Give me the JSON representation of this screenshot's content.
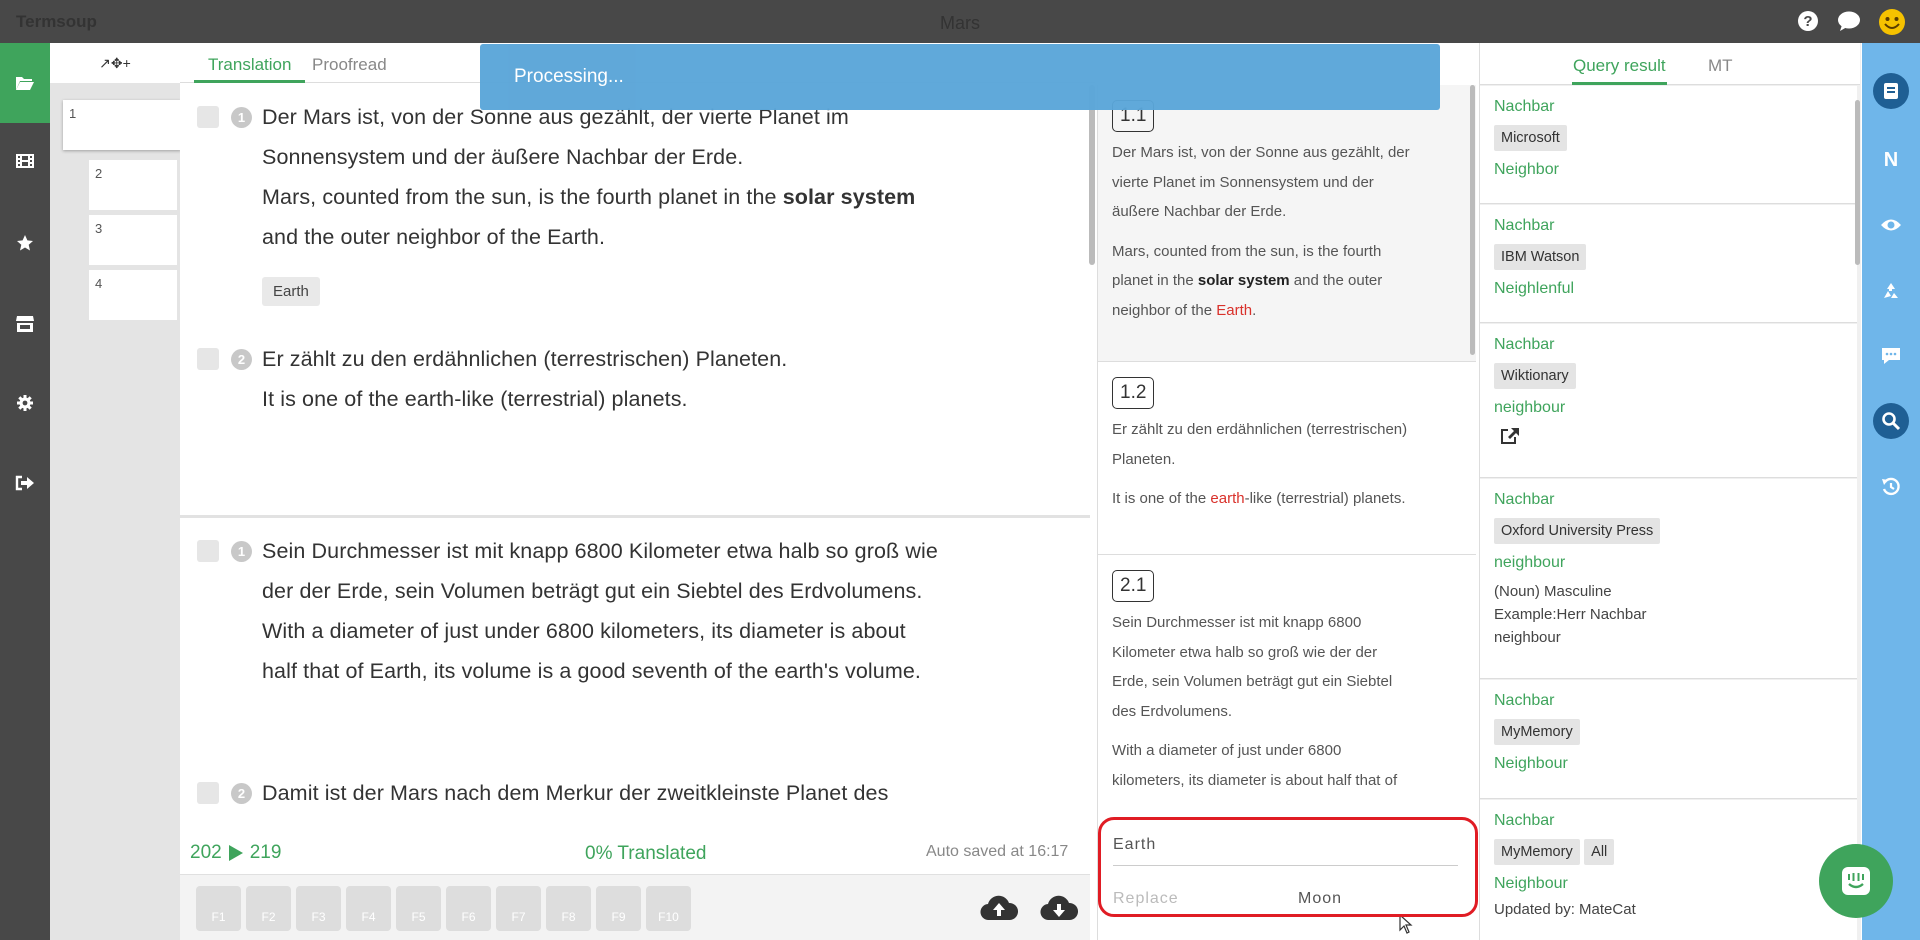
{
  "app": {
    "name": "Termsoup",
    "document_title": "Mars"
  },
  "topbar_icons": [
    "help-icon",
    "chat-icon",
    "smiley-avatar-icon"
  ],
  "left_nav": [
    "folder-icon",
    "film-icon",
    "star-icon",
    "store-icon",
    "gear-icon",
    "sign-out-icon"
  ],
  "thumbs": {
    "tools": "↗✥+",
    "pages": [
      "1",
      "2",
      "3",
      "4"
    ]
  },
  "tabs": {
    "translation": "Translation",
    "proofread": "Proofread"
  },
  "toast": "Processing...",
  "segments": [
    {
      "num": "1",
      "source": [
        "Der Mars ist, von der Sonne aus gezählt, der vierte Planet im",
        "Sonnensystem und der äußere Nachbar der Erde."
      ],
      "target_a": "Mars, counted from the sun, is the fourth planet in the ",
      "target_bold": "solar system",
      "target_b": "and the outer neighbor of the Earth.",
      "term": "Earth"
    },
    {
      "num": "2",
      "source": "Er zählt zu den erdähnlichen (terrestrischen) Planeten.",
      "target": "It is one of the earth-like (terrestrial) planets."
    },
    {
      "num": "1",
      "source": [
        "Sein Durchmesser ist mit knapp 6800 Kilometer etwa halb so groß wie",
        "der der Erde, sein Volumen beträgt gut ein Siebtel des Erdvolumens."
      ],
      "target": [
        "With a diameter of just under 6800 kilometers, its diameter is about",
        "half that of Earth, its volume is a good seventh of the earth's volume."
      ]
    },
    {
      "num": "2",
      "source": "Damit ist der Mars nach dem Merkur der zweitkleinste Planet des"
    }
  ],
  "status": {
    "from": "202",
    "to": "219",
    "progress": "0% Translated",
    "autosave": "Auto saved at 16:17"
  },
  "fkeys": [
    "F1",
    "F2",
    "F3",
    "F4",
    "F5",
    "F6",
    "F7",
    "F8",
    "F9",
    "F10"
  ],
  "cards": [
    {
      "idx": "1.1",
      "source": [
        "Der Mars ist, von der Sonne aus gezählt, der",
        "vierte Planet im Sonnensystem und der",
        "äußere Nachbar der Erde."
      ],
      "t1": "Mars, counted from the sun, is the fourth",
      "t2a": "planet in the ",
      "t2b": "solar system",
      "t2c": " and the outer",
      "t3a": "neighbor of the ",
      "t3b": "Earth",
      "t3c": "."
    },
    {
      "idx": "1.2",
      "source": [
        "Er zählt zu den erdähnlichen (terrestrischen)",
        "Planeten."
      ],
      "ta": "It is one of the ",
      "tb": "earth",
      "tc": "-like (terrestrial) planets."
    },
    {
      "idx": "2.1",
      "source": [
        "Sein Durchmesser ist mit knapp 6800",
        "Kilometer etwa halb so groß wie der der",
        "Erde, sein Volumen beträgt gut ein Siebtel",
        "des Erdvolumens."
      ],
      "target": [
        "With a diameter of just under 6800",
        "kilometers, its diameter is about half that of"
      ]
    }
  ],
  "search": {
    "find_value": "Earth",
    "replace_placeholder": "Replace",
    "replace_value": "Moon"
  },
  "right_tabs": {
    "query": "Query result",
    "mt": "MT"
  },
  "results": [
    {
      "term": "Nachbar",
      "source": "Microsoft",
      "translation": "Neighbor"
    },
    {
      "term": "Nachbar",
      "source": "IBM Watson",
      "translation": "Neighlenful"
    },
    {
      "term": "Nachbar",
      "source": "Wiktionary",
      "translation": "neighbour"
    },
    {
      "term": "Nachbar",
      "source": "Oxford University Press",
      "translation": "neighbour",
      "extra": [
        "(Noun) Masculine",
        "Example:Herr Nachbar",
        "neighbour"
      ]
    },
    {
      "term": "Nachbar",
      "source": "MyMemory",
      "translation": "Neighbour"
    },
    {
      "term": "Nachbar",
      "source": "MyMemory",
      "source2": "All",
      "translation": "Neighbour",
      "updated": "Updated by: MateCat"
    }
  ],
  "right_icons": [
    "book-icon",
    "n-icon",
    "eye-icon",
    "recycle-icon",
    "comment-icon",
    "search-icon",
    "history-icon"
  ],
  "colors": {
    "accent": "#3fa45c",
    "topbar": "#484848",
    "rightbar": "#6fb6ea",
    "toast": "#5aa5d8",
    "highlight": "#e01c24"
  }
}
